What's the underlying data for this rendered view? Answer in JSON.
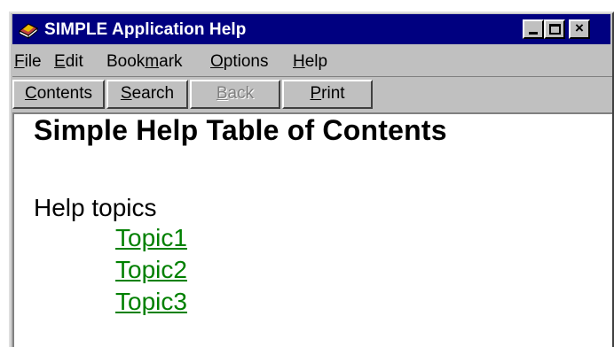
{
  "window": {
    "title": "SIMPLE Application Help",
    "icon": "help-book-icon"
  },
  "titlebar_buttons": {
    "minimize": "minimize-icon",
    "maximize": "maximize-icon",
    "close_glyph": "×"
  },
  "menu": {
    "items": [
      {
        "accel": "F",
        "rest": "ile"
      },
      {
        "accel": "E",
        "rest": "dit"
      },
      {
        "pre": "Book",
        "accel": "m",
        "rest": "ark"
      },
      {
        "accel": "O",
        "rest": "ptions"
      },
      {
        "accel": "H",
        "rest": "elp"
      }
    ]
  },
  "toolbar": {
    "contents": {
      "accel": "C",
      "rest": "ontents"
    },
    "search": {
      "accel": "S",
      "rest": "earch"
    },
    "back": {
      "accel": "B",
      "rest": "ack",
      "enabled": false
    },
    "print": {
      "accel": "P",
      "rest": "rint"
    }
  },
  "content": {
    "title": "Simple Help Table of Contents",
    "section_label": "Help topics",
    "topics": [
      "Topic1",
      "Topic2",
      "Topic3"
    ],
    "link_color": "#008000"
  },
  "colors": {
    "titlebar": "#000080",
    "chrome": "#c0c0c0"
  }
}
